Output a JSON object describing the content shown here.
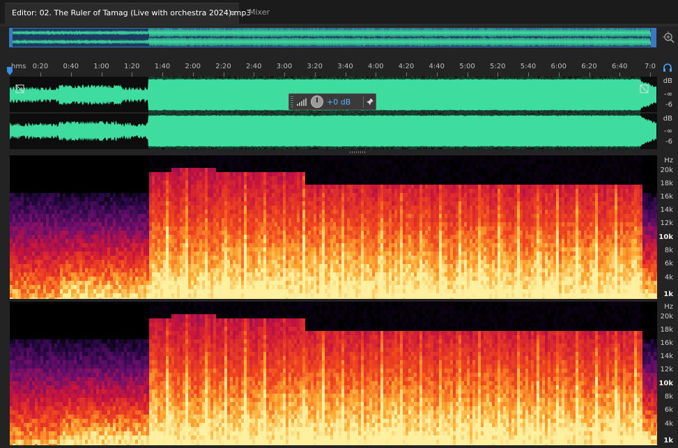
{
  "tabs": {
    "editor": {
      "label": "Editor: 02. The Ruler of Tamag (Live with orchestra 2024).mp3",
      "menu_glyph": "≡"
    },
    "mixer": {
      "label": "Mixer"
    }
  },
  "ruler": {
    "unit": "hms",
    "ticks": [
      "0:20",
      "0:40",
      "1:00",
      "1:20",
      "1:40",
      "2:00",
      "2:20",
      "2:40",
      "3:00",
      "3:20",
      "3:40",
      "4:00",
      "4:20",
      "4:40",
      "5:00",
      "5:20",
      "5:40",
      "6:00",
      "6:20",
      "6:40",
      "7:0"
    ]
  },
  "hud": {
    "gain": "+0 dB"
  },
  "db_scale": {
    "upper": [
      "dB",
      "-∞",
      "-6"
    ],
    "lower": [
      "dB",
      "-∞",
      "-6"
    ]
  },
  "hz_scale": {
    "labels": [
      "Hz",
      "20k",
      "18k",
      "16k",
      "14k",
      "12k",
      "10k",
      "8k",
      "6k",
      "4k",
      "1k"
    ],
    "bold": [
      "10k",
      "1k"
    ]
  },
  "icons": {
    "zoom": "zoom-in-icon",
    "monitor": "headphones-icon",
    "pin": "pin-icon",
    "playhead": "playhead-marker-icon"
  },
  "colors": {
    "waveform": "#3fdca0",
    "selection_border": "#3a78c2",
    "spectral_hot": "#fff0a0",
    "spectral_cold": "#2a0a40",
    "accent_value": "#5fb0ff"
  }
}
